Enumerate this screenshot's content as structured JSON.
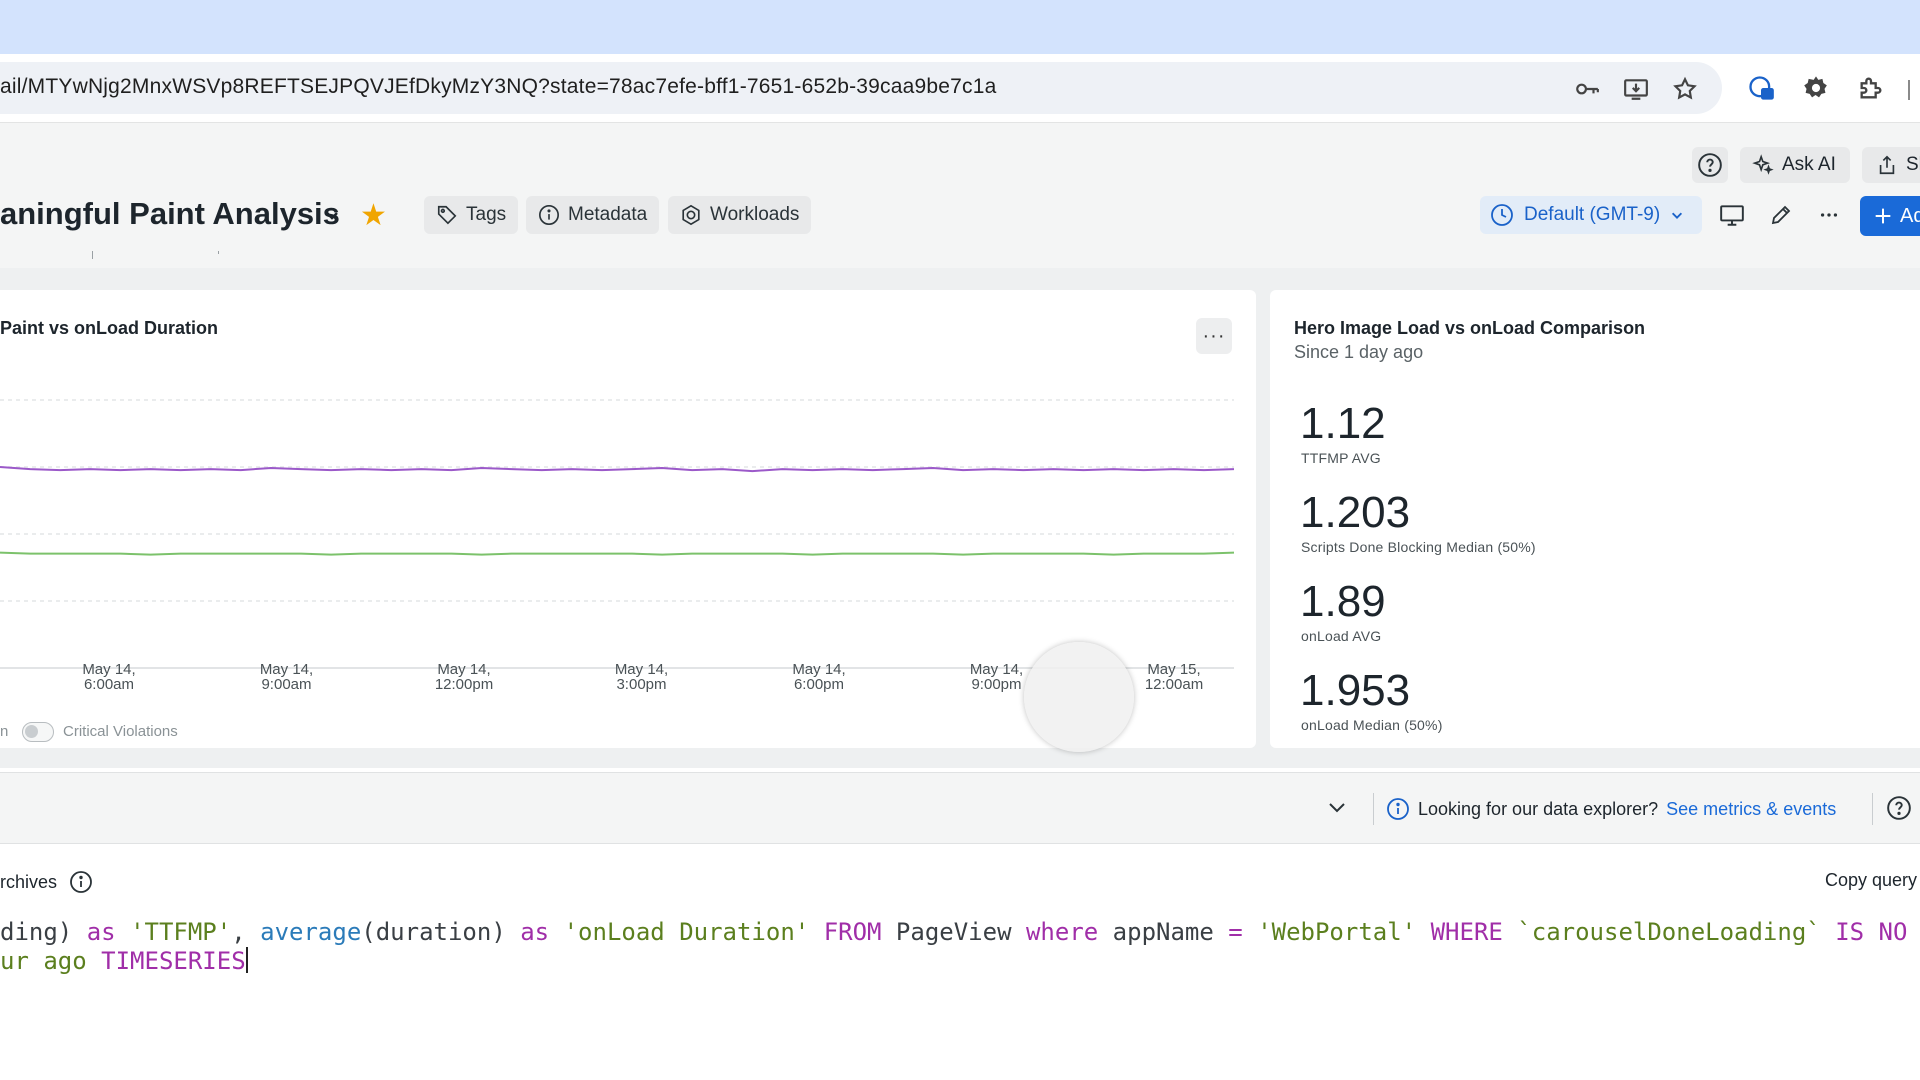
{
  "browser": {
    "url": "ail/MTYwNjg2MnxWSVp8REFTSEJPQVJEfDkyMzY3NQ?state=78ac7efe-bff1-7651-652b-39caa9be7c1a",
    "icons": [
      "key-icon",
      "install-icon",
      "bookmark-star-icon",
      "profile-lock-icon",
      "settings-gear-icon",
      "extensions-puzzle-icon"
    ]
  },
  "header": {
    "title": "aningful Paint Analysis",
    "ask_ai_label": "Ask AI",
    "share_label": "Sh",
    "chips": [
      {
        "label": "Tags",
        "icon": "tag-icon"
      },
      {
        "label": "Metadata",
        "icon": "info-icon"
      },
      {
        "label": "Workloads",
        "icon": "workloads-icon"
      }
    ],
    "timezone_label": "Default (GMT-9)",
    "add_label": "Ad",
    "star_color": "#f0a500",
    "accent_color": "#1a6ad8"
  },
  "left_widget": {
    "title": "Paint vs onLoad Duration",
    "legend_prefix": "n",
    "legend_toggle_label": "Critical Violations"
  },
  "chart_data": {
    "type": "line",
    "title": "Paint vs onLoad Duration",
    "x_ticks": [
      [
        "May 14,",
        "6:00am"
      ],
      [
        "May 14,",
        "9:00am"
      ],
      [
        "May 14,",
        "12:00pm"
      ],
      [
        "May 14,",
        "3:00pm"
      ],
      [
        "May 14,",
        "6:00pm"
      ],
      [
        "May 14,",
        "9:00pm"
      ],
      [
        "May 15,",
        "12:00am"
      ]
    ],
    "grid": true,
    "series": [
      {
        "color": "#9b59c9",
        "values": [
          1.95,
          1.93,
          1.92,
          1.93,
          1.92,
          1.93,
          1.92,
          1.93,
          1.92,
          1.94,
          1.93,
          1.92,
          1.93,
          1.92,
          1.93,
          1.92,
          1.94,
          1.93,
          1.92,
          1.93,
          1.92,
          1.93,
          1.94,
          1.92,
          1.93,
          1.91,
          1.93,
          1.92,
          1.93,
          1.92,
          1.93,
          1.94,
          1.92,
          1.93,
          1.92,
          1.93,
          1.92,
          1.93,
          1.92,
          1.93,
          1.92,
          1.93
        ]
      },
      {
        "color": "#7cc26b",
        "values": [
          1.12,
          1.11,
          1.11,
          1.11,
          1.11,
          1.1,
          1.11,
          1.11,
          1.11,
          1.11,
          1.11,
          1.1,
          1.11,
          1.11,
          1.11,
          1.11,
          1.1,
          1.11,
          1.11,
          1.11,
          1.11,
          1.11,
          1.1,
          1.11,
          1.11,
          1.11,
          1.11,
          1.1,
          1.11,
          1.11,
          1.11,
          1.11,
          1.1,
          1.11,
          1.11,
          1.11,
          1.11,
          1.1,
          1.11,
          1.11,
          1.11,
          1.12
        ]
      }
    ],
    "ylim": [
      0,
      2.6
    ]
  },
  "right_widget": {
    "title": "Hero Image Load vs onLoad Comparison",
    "subtitle": "Since 1 day ago",
    "stats": [
      {
        "value": "1.12",
        "label": "TTFMP AVG"
      },
      {
        "value": "1.203",
        "label": "Scripts Done Blocking Median (50%)"
      },
      {
        "value": "1.89",
        "label": "onLoad AVG"
      },
      {
        "value": "1.953",
        "label": "onLoad Median (50%)"
      }
    ]
  },
  "footer_bar": {
    "explorer_text": "Looking for our data explorer?",
    "explorer_link": "See metrics & events"
  },
  "query": {
    "heading": "rchives",
    "copy_label": "Copy query",
    "line1": [
      {
        "t": "ding) ",
        "c": "tok"
      },
      {
        "t": "as",
        "c": "kw"
      },
      {
        "t": " ",
        "c": "tok"
      },
      {
        "t": "'TTFMP'",
        "c": "str"
      },
      {
        "t": ", ",
        "c": "tok"
      },
      {
        "t": "average",
        "c": "fn"
      },
      {
        "t": "(duration) ",
        "c": "tok"
      },
      {
        "t": "as",
        "c": "kw"
      },
      {
        "t": " ",
        "c": "tok"
      },
      {
        "t": "'onLoad Duration'",
        "c": "str"
      },
      {
        "t": " ",
        "c": "tok"
      },
      {
        "t": "FROM",
        "c": "kw"
      },
      {
        "t": " PageView ",
        "c": "tok"
      },
      {
        "t": "where",
        "c": "kw"
      },
      {
        "t": " appName ",
        "c": "tok"
      },
      {
        "t": "=",
        "c": "kw"
      },
      {
        "t": " ",
        "c": "tok"
      },
      {
        "t": "'WebPortal'",
        "c": "str"
      },
      {
        "t": " ",
        "c": "tok"
      },
      {
        "t": "WHERE",
        "c": "kw"
      },
      {
        "t": " ",
        "c": "tok"
      },
      {
        "t": "`carouselDoneLoading`",
        "c": "str"
      },
      {
        "t": " ",
        "c": "tok"
      },
      {
        "t": "IS NO",
        "c": "kw"
      }
    ],
    "line2": [
      {
        "t": "ur ago ",
        "c": "str"
      },
      {
        "t": "TIMESERIES",
        "c": "kw"
      }
    ]
  }
}
